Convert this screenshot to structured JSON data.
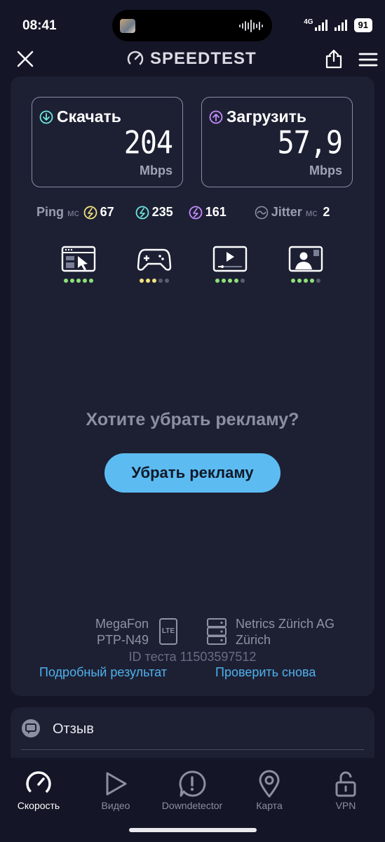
{
  "status_bar": {
    "time": "08:41",
    "network": "4G",
    "battery": "91"
  },
  "header": {
    "title": "SPEEDTEST"
  },
  "download": {
    "label": "Скачать",
    "value": "204",
    "unit": "Mbps"
  },
  "upload": {
    "label": "Загрузить",
    "value": "57,9",
    "unit": "Mbps"
  },
  "ping": {
    "label": "Ping",
    "unit": "мс",
    "idle": "67",
    "download": "235",
    "upload": "161"
  },
  "jitter": {
    "label": "Jitter",
    "unit": "мс",
    "value": "2"
  },
  "quality": [
    {
      "icon": "web-browsing-icon",
      "rating": 5,
      "color": "#8ee07a"
    },
    {
      "icon": "gaming-icon",
      "rating": 3,
      "color": "#f2e27d"
    },
    {
      "icon": "video-streaming-icon",
      "rating": 4,
      "color": "#8ee07a"
    },
    {
      "icon": "video-call-icon",
      "rating": 4,
      "color": "#8ee07a"
    }
  ],
  "ad": {
    "question": "Хотите убрать рекламу?",
    "button": "Убрать рекламу"
  },
  "provider": {
    "name": "MegaFon",
    "ip": "PTP-N49",
    "tech": "LTE"
  },
  "server": {
    "name": "Netrics Zürich AG",
    "city": "Zürich"
  },
  "test_id": "ID теста 11503597512",
  "links": {
    "details": "Подробный результат",
    "retry": "Проверить снова"
  },
  "feedback": {
    "label": "Отзыв"
  },
  "tabs": [
    {
      "label": "Скорость",
      "icon": "speedometer-icon",
      "active": true
    },
    {
      "label": "Видео",
      "icon": "play-icon",
      "active": false
    },
    {
      "label": "Downdetector",
      "icon": "alert-icon",
      "active": false
    },
    {
      "label": "Карта",
      "icon": "map-pin-icon",
      "active": false
    },
    {
      "label": "VPN",
      "icon": "lock-icon",
      "active": false
    }
  ],
  "colors": {
    "accent": "#5cbcf2",
    "download": "#6ee7e0",
    "upload": "#c58cff",
    "ping_idle": "#f2e27d"
  }
}
